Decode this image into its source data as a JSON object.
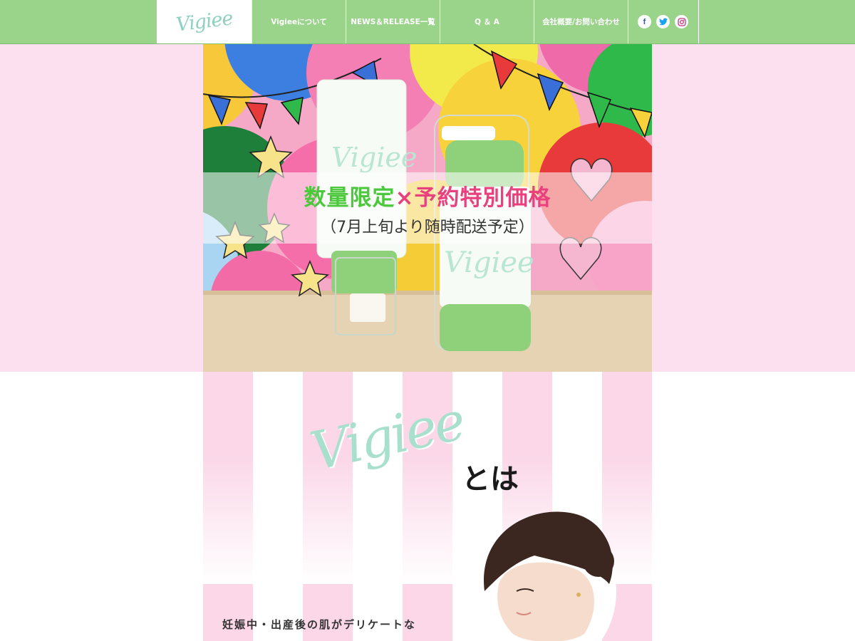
{
  "nav": {
    "logo": "Vigiee",
    "items": [
      {
        "label": "Vigieeについて"
      },
      {
        "label": "NEWS＆RELEASE一覧"
      },
      {
        "label": "Q ＆ A"
      },
      {
        "label": "会社概要/お問い合わせ"
      }
    ],
    "social": [
      {
        "icon": "facebook-icon",
        "glyph": "f",
        "color": "#3b5998"
      },
      {
        "icon": "twitter-icon",
        "color": "#1da1f2"
      },
      {
        "icon": "instagram-icon",
        "color": "#c13584"
      }
    ]
  },
  "hero": {
    "line1_green": "数量限定",
    "line1_x": "×",
    "line1_pink": "予約特別価格",
    "line2": "（7月上旬より随時配送予定）",
    "product_label_tube": "Vigiee",
    "product_label_bottle": "Vigiee"
  },
  "about": {
    "logo": "Vigiee",
    "suffix": "とは",
    "tagline": "妊娠中・出産後の肌がデリケートな"
  },
  "colors": {
    "nav_green": "#9ad38a",
    "hero_pink_band": "#fde0ef",
    "stripe_pink": "#fbd7e8",
    "accent_green": "#4cc83c",
    "accent_pink": "#e8417e",
    "logo_mint": "#a9e0cd"
  }
}
